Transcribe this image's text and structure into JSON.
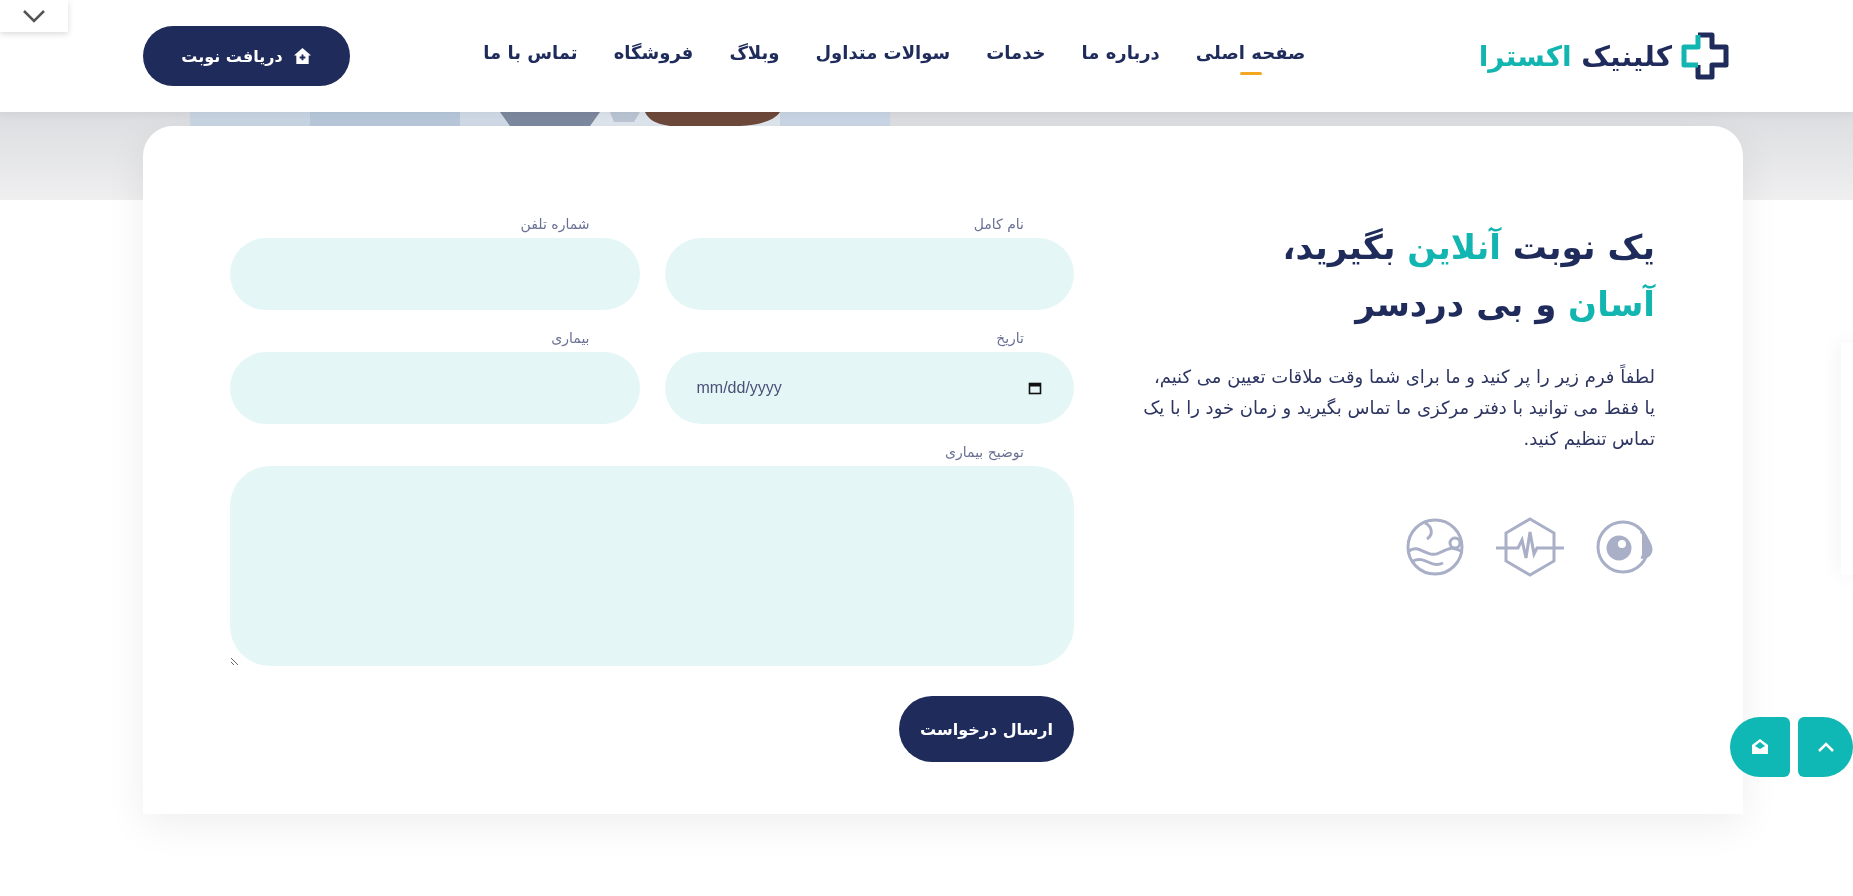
{
  "header": {
    "logo": {
      "name": "کلینیک",
      "accent": "اکسترا"
    },
    "nav": [
      {
        "label": "صفحه اصلی",
        "selected": true
      },
      {
        "label": "درباره ما",
        "selected": false
      },
      {
        "label": "خدمات",
        "selected": false
      },
      {
        "label": "سوالات متداول",
        "selected": false
      },
      {
        "label": "وبلاگ",
        "selected": false
      },
      {
        "label": "فروشگاه",
        "selected": false
      },
      {
        "label": "تماس با ما",
        "selected": false
      }
    ],
    "cta_button": "دریافت نوبت"
  },
  "intro": {
    "heading": [
      [
        {
          "text": "یک نوبت",
          "accent": false
        },
        {
          "text": "آنلاین",
          "accent": true
        },
        {
          "text": "بگیرید،",
          "accent": false
        }
      ],
      [
        {
          "text": "آسان",
          "accent": true
        },
        {
          "text": "و بی دردسر",
          "accent": false
        }
      ]
    ],
    "description": "لطفاً فرم زیر را پر کنید و ما برای شما وقت ملاقات تعیین می کنیم، یا فقط می توانید با دفتر مرکزی ما تماس بگیرید و زمان خود را با یک تماس تنظیم کنید."
  },
  "form": {
    "fields": [
      {
        "label": "نام کامل",
        "kind": "text"
      },
      {
        "label": "شماره تلفن",
        "kind": "text"
      },
      {
        "label": "تاریخ",
        "kind": "date",
        "placeholder": "mm/dd/yyyy"
      },
      {
        "label": "بیماری",
        "kind": "text"
      },
      {
        "label": "توضیح بیماری",
        "kind": "textarea"
      }
    ],
    "submit": "ارسال درخواست"
  }
}
